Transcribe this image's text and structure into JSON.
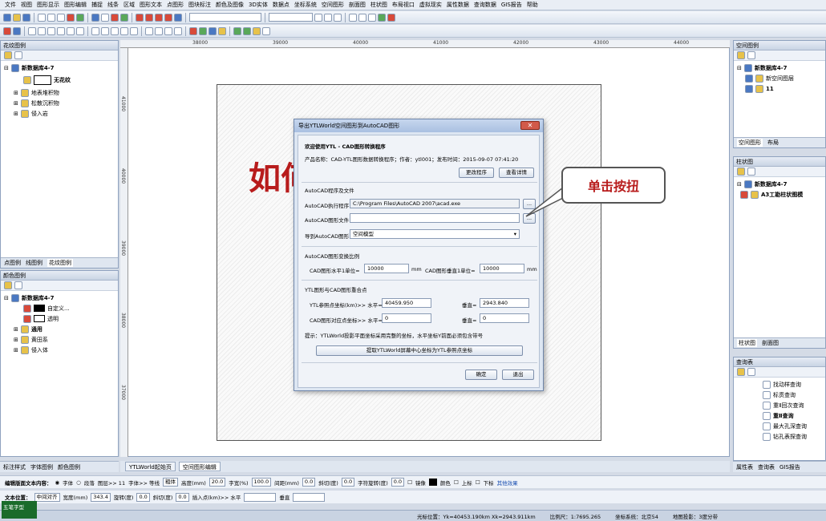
{
  "menu": [
    "文件",
    "视图",
    "图形显示",
    "图形编辑",
    "捕捉",
    "线条",
    "区域",
    "图形文本",
    "点图形",
    "图块标注",
    "颜色及图像",
    "3D实体",
    "数据点",
    "坐标系统",
    "空间图形",
    "剖面图",
    "柱状图",
    "布局视口",
    "虚拟现实",
    "属性数据",
    "查询数据",
    "GIS报告",
    "帮助"
  ],
  "left_panel_a": {
    "title": "花纹图例",
    "tree": [
      "新数据库4-7",
      "无花纹",
      "地表堆积物",
      "松散沉积物",
      "侵入岩"
    ],
    "tabs": [
      "点图例",
      "线图例",
      "花纹图例"
    ]
  },
  "left_panel_b": {
    "title": "颜色图例",
    "tree": [
      "新数据库4-7",
      "自定义...",
      "透明",
      "通用",
      "黄田系",
      "侵入体"
    ]
  },
  "right_panel_a": {
    "title": "空间图例",
    "tree": [
      "新数据库4-7",
      "新空间图层",
      "11"
    ],
    "tabs": [
      "空间图形",
      "布局"
    ]
  },
  "right_panel_b": {
    "title": "柱状图",
    "tree": [
      "新数据库4-7",
      "A3工勘柱状图模"
    ],
    "tabs": [
      "柱状图",
      "剖面图"
    ]
  },
  "right_panel_c": {
    "title": "查询表",
    "items": [
      "找动样查询",
      "标贯查询",
      "重Ⅱ回次查询",
      "重Ⅱ查询",
      "最大孔深查询",
      "钻孔表探查询"
    ]
  },
  "ruler": {
    "top": [
      "38000",
      "39000",
      "40000",
      "41000",
      "42000",
      "43000",
      "44000"
    ],
    "left": [
      "41000",
      "40000",
      "39000",
      "38000",
      "37000"
    ]
  },
  "overlay": {
    "big_text": "如何…………形",
    "callout": "单击按扭"
  },
  "dialog": {
    "title": "导出YTLWorld空间图形到AutoCAD图形",
    "welcome": "欢迎使用YTL - CAD图形转换程序",
    "product": "产品名称：CAD-YTL图形数据转换程序；作者：ytl001；发布时间：2015-09-07 07:41:20",
    "btn_change": "更改程序",
    "btn_detail": "查看详情",
    "section_cad": "AutoCAD程序及文件",
    "exe_label": "AutoCAD执行程序",
    "exe_value": "C:\\Program Files\\AutoCAD 2007\\acad.exe",
    "file_label": "AutoCAD图形文件",
    "file_value": "",
    "export_label": "导到AutoCAD图形",
    "export_value": "空间模型",
    "section_scale": "AutoCAD图形变换比例",
    "h_label": "CAD图形水平1单位=",
    "h_value": "10000",
    "h_unit": "mm",
    "v_label": "CAD图形垂直1单位=",
    "v_value": "10000",
    "v_unit": "mm",
    "section_ref": "YTL图形与CAD图形重合点",
    "ytl_label": "YTL参照点坐标(km)>> 水平=",
    "ytl_h": "40459.950",
    "ytl_v_label": "垂直=",
    "ytl_v": "2943.840",
    "cad_label": "CAD图形对应点坐标>> 水平=",
    "cad_h": "0",
    "cad_v_label": "垂直=",
    "cad_v": "0",
    "hint": "提示：YTLWorld投影平面坐标采用完整的坐标，水平坐标Y前面必须包含带号",
    "btn_extract": "提取YTLWorld屏幕中心坐标为YTL参照点坐标",
    "btn_ok": "确定",
    "btn_cancel": "退出",
    "browse": "..."
  },
  "doc_tabs": [
    "YTLWorld起始页",
    "空间图形编辑"
  ],
  "left_bottom_tabs": [
    "标注样式",
    "字体图例",
    "颜色图例"
  ],
  "right_bottom_tabs": [
    "属性表",
    "查询表",
    "GIS报告"
  ],
  "edit_bar": {
    "label": "编辑版面文本内容：",
    "font": "字体",
    "para": "段落",
    "layer": "图层>> 11",
    "font2": "字体>> 等线",
    "weight": "粗体",
    "height_label": "高度(mm)",
    "height": "20.0",
    "width_label": "字宽(%)",
    "width": "100.0",
    "space_label": "间距(mm)",
    "space": "0.0",
    "slope_label": "斜切(度)",
    "slope": "0.0",
    "rot_label": "字符旋转(度)",
    "rot": "0.0",
    "mirror": "镜像",
    "color": "颜色",
    "up": "上标",
    "down": "下标",
    "other": "其他效果"
  },
  "edit_bar2": {
    "label": "文本位置：",
    "align": "中间对齐",
    "w_label": "宽度(mm)",
    "w": "343.4",
    "r_label": "旋转(度)",
    "r": "0.0",
    "s_label": "斜切(度)",
    "s": "0.0",
    "ins": "插入点(km)>> 水平",
    "vert": "垂直"
  },
  "status": {
    "coords": "光标位置：Yk=40453.190km Xk=2943.911km",
    "scale": "比例尺：1:7695.265",
    "crs": "坐标系统：北京54",
    "proj": "地图投影：3度分带"
  },
  "ime": "五笔字型"
}
